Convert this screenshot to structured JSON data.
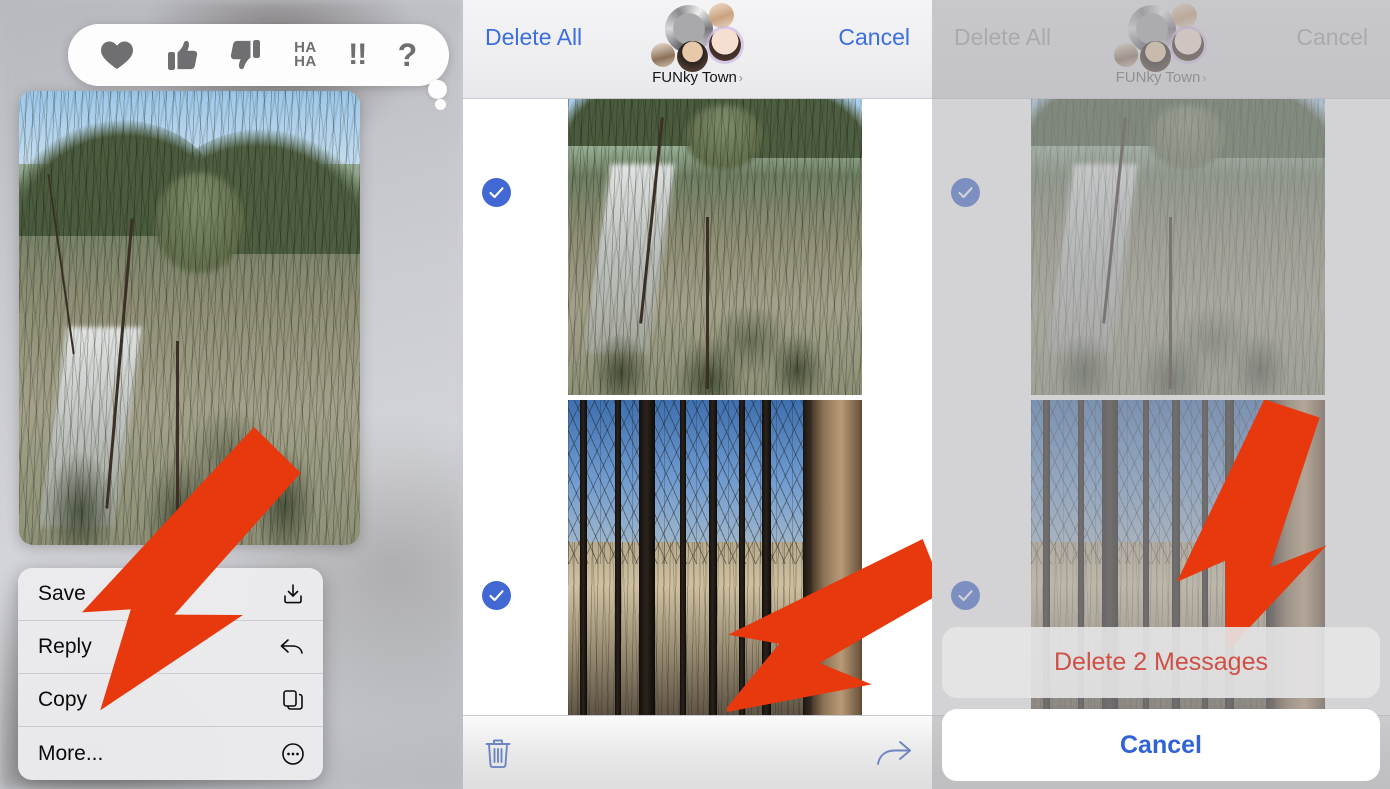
{
  "panel1": {
    "name": "message-context-menu-panel",
    "reactions": [
      {
        "id": "heart",
        "label": "Love",
        "icon": "heart-icon"
      },
      {
        "id": "thumbsup",
        "label": "Like",
        "icon": "thumbs-up-icon"
      },
      {
        "id": "thumbsdown",
        "label": "Dislike",
        "icon": "thumbs-down-icon"
      },
      {
        "id": "haha",
        "label": "HA HA",
        "line1": "HA",
        "line2": "HA",
        "icon": "haha-icon"
      },
      {
        "id": "exclamation",
        "label": "!!",
        "text": "!!",
        "icon": "exclamation-icon"
      },
      {
        "id": "question",
        "label": "?",
        "text": "?",
        "icon": "question-icon"
      }
    ],
    "photo_alt": "Gorge with waterfall and bare trees under blue sky",
    "menu": [
      {
        "label": "Save",
        "icon": "save-download-icon"
      },
      {
        "label": "Reply",
        "icon": "reply-arrow-icon"
      },
      {
        "label": "Copy",
        "icon": "copy-pages-icon"
      },
      {
        "label": "More...",
        "icon": "more-ellipsis-icon"
      }
    ],
    "annotation_arrow": {
      "color": "#E8380D",
      "points_to": "More..."
    }
  },
  "panel2": {
    "name": "select-messages-panel",
    "header": {
      "left_button": "Delete All",
      "right_button": "Cancel",
      "group_name": "FUNky Town",
      "chevron": "›",
      "avatar_count": 5,
      "enabled": true
    },
    "messages": [
      {
        "selected": true,
        "photo_alt": "Gorge with creek and bare trees",
        "checkmark": "✓"
      },
      {
        "selected": true,
        "photo_alt": "Tall forest tree trunks against blue sky",
        "checkmark": "✓"
      }
    ],
    "toolbar": {
      "delete_icon": "trash-icon",
      "forward_icon": "forward-share-arrow-icon"
    },
    "annotation_arrow": {
      "color": "#E8380D",
      "points_to": "trash-icon"
    }
  },
  "panel3": {
    "name": "delete-confirmation-panel",
    "header": {
      "left_button": "Delete All",
      "right_button": "Cancel",
      "group_name": "FUNky Town",
      "chevron": "›",
      "enabled": false
    },
    "messages": [
      {
        "selected": true,
        "photo_alt": "Gorge with creek and bare trees",
        "checkmark": "✓"
      },
      {
        "selected": true,
        "photo_alt": "Tall forest tree trunks against blue sky",
        "checkmark": "✓"
      }
    ],
    "action_sheet": {
      "destructive_label": "Delete 2 Messages",
      "cancel_label": "Cancel",
      "destructive_color": "#D05046",
      "cancel_color": "#2F63D6"
    },
    "annotation_arrow": {
      "color": "#E8380D",
      "points_to": "Delete 2 Messages"
    }
  },
  "colors": {
    "ios_blue": "#3B6FE0",
    "selection_blue": "#4268D3",
    "annotation_red": "#E8380D",
    "destructive_red": "#D05046",
    "panel_grey": "#C7C7CB"
  }
}
